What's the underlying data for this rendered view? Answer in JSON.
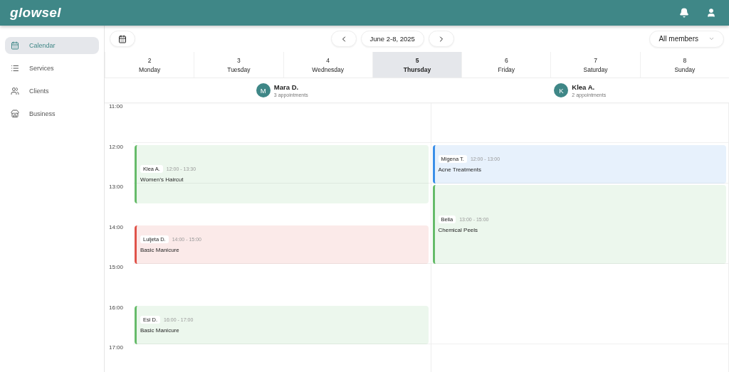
{
  "app": {
    "logo": "glowsel"
  },
  "sidebar": {
    "items": [
      {
        "label": "Calendar",
        "selected": true
      },
      {
        "label": "Services",
        "selected": false
      },
      {
        "label": "Clients",
        "selected": false
      },
      {
        "label": "Business",
        "selected": false
      }
    ]
  },
  "toolbar": {
    "range": "June 2-8, 2025",
    "member_filter": "All members"
  },
  "days": [
    {
      "date": "2",
      "name": "Monday",
      "selected": false
    },
    {
      "date": "3",
      "name": "Tuesday",
      "selected": false
    },
    {
      "date": "4",
      "name": "Wednesday",
      "selected": false
    },
    {
      "date": "5",
      "name": "Thursday",
      "selected": true
    },
    {
      "date": "6",
      "name": "Friday",
      "selected": false
    },
    {
      "date": "7",
      "name": "Saturday",
      "selected": false
    },
    {
      "date": "8",
      "name": "Sunday",
      "selected": false
    }
  ],
  "hours": [
    "11:00",
    "12:00",
    "13:00",
    "14:00",
    "15:00",
    "16:00",
    "17:00"
  ],
  "members": [
    {
      "initial": "M",
      "name": "Mara D.",
      "count": "3 appointments",
      "events": [
        {
          "client": "Klea A.",
          "time": "12:00 - 13:30",
          "service": "Women's Haircut",
          "color": "#66bb6a"
        },
        {
          "client": "Luljeta D.",
          "time": "14:00 - 15:00",
          "service": "Basic Manicure",
          "color": "#e0534a"
        },
        {
          "client": "Esi D.",
          "time": "16:00 - 17:00",
          "service": "Basic Manicure",
          "color": "#66bb6a"
        }
      ]
    },
    {
      "initial": "K",
      "name": "Klea A.",
      "count": "2 appointments",
      "events": [
        {
          "client": "Migena T.",
          "time": "12:00 - 13:00",
          "service": "Acne Treatments",
          "color": "#3b8fe8"
        },
        {
          "client": "Bella",
          "time": "13:00 - 15:00",
          "service": "Chemical Peels",
          "color": "#66bb6a"
        }
      ]
    }
  ]
}
